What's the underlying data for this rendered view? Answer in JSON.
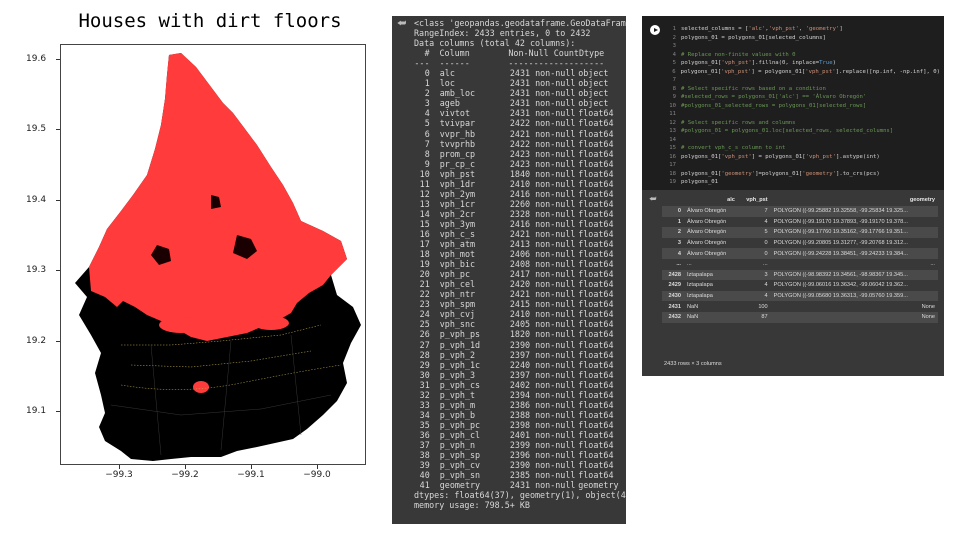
{
  "map": {
    "title": "Houses with dirt floors",
    "yticks": [
      "19.6",
      "19.5",
      "19.4",
      "19.3",
      "19.2",
      "19.1"
    ],
    "xticks": [
      "−99.3",
      "−99.2",
      "−99.1",
      "−99.0"
    ],
    "colors": {
      "background": "#000000",
      "fill": "#ff3b3b",
      "highlight": "#ffe066"
    }
  },
  "info": {
    "output_icon": "output-icon",
    "header_lines": [
      "<class 'geopandas.geodataframe.GeoDataFrame'>",
      "RangeIndex: 2433 entries, 0 to 2432",
      "Data columns (total 42 columns):"
    ],
    "col_header": {
      "num": "#",
      "column": "Column",
      "count": "Non-Null Count",
      "dtype": "Dtype"
    },
    "col_sep": {
      "num": "---",
      "column": "------",
      "count": "--------------",
      "dtype": "-----"
    },
    "rows": [
      [
        "0",
        "alc",
        "2431 non-null",
        "object"
      ],
      [
        "1",
        "loc",
        "2431 non-null",
        "object"
      ],
      [
        "2",
        "amb_loc",
        "2431 non-null",
        "object"
      ],
      [
        "3",
        "ageb",
        "2431 non-null",
        "object"
      ],
      [
        "4",
        "vivtot",
        "2431 non-null",
        "float64"
      ],
      [
        "5",
        "tvivpar",
        "2422 non-null",
        "float64"
      ],
      [
        "6",
        "vvpr_hb",
        "2421 non-null",
        "float64"
      ],
      [
        "7",
        "tvvprhb",
        "2422 non-null",
        "float64"
      ],
      [
        "8",
        "prom_cp",
        "2423 non-null",
        "float64"
      ],
      [
        "9",
        "pr_cp_c",
        "2423 non-null",
        "float64"
      ],
      [
        "10",
        "vph_pst",
        "1840 non-null",
        "float64"
      ],
      [
        "11",
        "vph_1dr",
        "2410 non-null",
        "float64"
      ],
      [
        "12",
        "vph_2ym",
        "2416 non-null",
        "float64"
      ],
      [
        "13",
        "vph_1cr",
        "2260 non-null",
        "float64"
      ],
      [
        "14",
        "vph_2cr",
        "2328 non-null",
        "float64"
      ],
      [
        "15",
        "vph_3ym",
        "2416 non-null",
        "float64"
      ],
      [
        "16",
        "vph_c_s",
        "2421 non-null",
        "float64"
      ],
      [
        "17",
        "vph_atm",
        "2413 non-null",
        "float64"
      ],
      [
        "18",
        "vph_mot",
        "2406 non-null",
        "float64"
      ],
      [
        "19",
        "vph_bic",
        "2408 non-null",
        "float64"
      ],
      [
        "20",
        "vph_pc",
        "2417 non-null",
        "float64"
      ],
      [
        "21",
        "vph_cel",
        "2420 non-null",
        "float64"
      ],
      [
        "22",
        "vph_ntr",
        "2421 non-null",
        "float64"
      ],
      [
        "23",
        "vph_spm",
        "2415 non-null",
        "float64"
      ],
      [
        "24",
        "vph_cvj",
        "2410 non-null",
        "float64"
      ],
      [
        "25",
        "vph_snc",
        "2405 non-null",
        "float64"
      ],
      [
        "26",
        "p_vph_ps",
        "1820 non-null",
        "float64"
      ],
      [
        "27",
        "p_vph_1d",
        "2390 non-null",
        "float64"
      ],
      [
        "28",
        "p_vph_2",
        "2397 non-null",
        "float64"
      ],
      [
        "29",
        "p_vph_1c",
        "2240 non-null",
        "float64"
      ],
      [
        "30",
        "p_vph_3",
        "2397 non-null",
        "float64"
      ],
      [
        "31",
        "p_vph_cs",
        "2402 non-null",
        "float64"
      ],
      [
        "32",
        "p_vph_t",
        "2394 non-null",
        "float64"
      ],
      [
        "33",
        "p_vph_m",
        "2386 non-null",
        "float64"
      ],
      [
        "34",
        "p_vph_b",
        "2388 non-null",
        "float64"
      ],
      [
        "35",
        "p_vph_pc",
        "2398 non-null",
        "float64"
      ],
      [
        "36",
        "p_vph_cl",
        "2401 non-null",
        "float64"
      ],
      [
        "37",
        "p_vph_n",
        "2399 non-null",
        "float64"
      ],
      [
        "38",
        "p_vph_sp",
        "2396 non-null",
        "float64"
      ],
      [
        "39",
        "p_vph_cv",
        "2390 non-null",
        "float64"
      ],
      [
        "40",
        "p_vph_sn",
        "2385 non-null",
        "float64"
      ],
      [
        "41",
        "geometry",
        "2431 non-null",
        "geometry"
      ]
    ],
    "footer_lines": [
      "dtypes: float64(37), geometry(1), object(4)",
      "memory usage: 798.5+ KB"
    ]
  },
  "code": {
    "lines": [
      [
        [
          "n",
          "1"
        ],
        [
          "t",
          "selected_columns = ["
        ],
        [
          "s",
          "'alc'"
        ],
        [
          "t",
          ","
        ],
        [
          "s",
          "'vph_pst'"
        ],
        [
          "t",
          ", "
        ],
        [
          "s",
          "'geometry'"
        ],
        [
          "t",
          "]"
        ]
      ],
      [
        [
          "n",
          "2"
        ],
        [
          "t",
          "polygons_01 = polygons_01[selected_columns]"
        ]
      ],
      [
        [
          "n",
          "3"
        ]
      ],
      [
        [
          "n",
          "4"
        ],
        [
          "c",
          "# Replace non-finite values with 0"
        ]
      ],
      [
        [
          "n",
          "5"
        ],
        [
          "t",
          "polygons_01["
        ],
        [
          "s",
          "'vph_pst'"
        ],
        [
          "t",
          "].fillna(0, inplace="
        ],
        [
          "k",
          "True"
        ],
        [
          "t",
          ")"
        ]
      ],
      [
        [
          "n",
          "6"
        ],
        [
          "t",
          "polygons_01["
        ],
        [
          "s",
          "'vph_pst'"
        ],
        [
          "t",
          "] = polygons_01["
        ],
        [
          "s",
          "'vph_pst'"
        ],
        [
          "t",
          "].replace([np.inf, -np.inf], 0)"
        ]
      ],
      [
        [
          "n",
          "7"
        ]
      ],
      [
        [
          "n",
          "8"
        ],
        [
          "c",
          "# Select specific rows based on a condition"
        ]
      ],
      [
        [
          "n",
          "9"
        ],
        [
          "c",
          "#selected_rows = polygons_01['alc'] == 'Álvaro Obregón'"
        ]
      ],
      [
        [
          "n",
          "10"
        ],
        [
          "c",
          "#polygons_01_selected_rows = polygons_01[selected_rows]"
        ]
      ],
      [
        [
          "n",
          "11"
        ]
      ],
      [
        [
          "n",
          "12"
        ],
        [
          "c",
          "# Select specific rows and columns"
        ]
      ],
      [
        [
          "n",
          "13"
        ],
        [
          "c",
          "#polygons_01 = polygons_01.loc[selected_rows, selected_columns]"
        ]
      ],
      [
        [
          "n",
          "14"
        ]
      ],
      [
        [
          "n",
          "15"
        ],
        [
          "c",
          "# convert vph_c_s column to int"
        ]
      ],
      [
        [
          "n",
          "16"
        ],
        [
          "t",
          "polygons_01["
        ],
        [
          "s",
          "'vph_pst'"
        ],
        [
          "t",
          "] = polygons_01["
        ],
        [
          "s",
          "'vph_pst'"
        ],
        [
          "t",
          "].astype(int)"
        ]
      ],
      [
        [
          "n",
          "17"
        ]
      ],
      [
        [
          "n",
          "18"
        ],
        [
          "t",
          "polygons_01["
        ],
        [
          "s",
          "'geometry'"
        ],
        [
          "t",
          "]=polygons_01["
        ],
        [
          "s",
          "'geometry'"
        ],
        [
          "t",
          "].to_crs(pcs)"
        ]
      ],
      [
        [
          "n",
          "19"
        ],
        [
          "t",
          "polygons_01"
        ]
      ]
    ]
  },
  "dataframe": {
    "columns": [
      "",
      "alc",
      "vph_pst",
      "geometry"
    ],
    "rows": [
      [
        "0",
        "Álvaro Obregón",
        "7",
        "POLYGON ((-99.25882 19.32558, -99.25834 19.325..."
      ],
      [
        "1",
        "Álvaro Obregón",
        "4",
        "POLYGON ((-99.19170 19.37893, -99.19170 19.378..."
      ],
      [
        "2",
        "Álvaro Obregón",
        "5",
        "POLYGON ((-99.17760 19.35162, -99.17766 19.351..."
      ],
      [
        "3",
        "Álvaro Obregón",
        "0",
        "POLYGON ((-99.20805 19.31277, -99.20768 19.312..."
      ],
      [
        "4",
        "Álvaro Obregón",
        "0",
        "POLYGON ((-99.24228 19.38451, -99.24233 19.384..."
      ],
      [
        "...",
        "...",
        "...",
        "..."
      ],
      [
        "2428",
        "Iztapalapa",
        "3",
        "POLYGON ((-98.98392 19.34561, -98.98367 19.345..."
      ],
      [
        "2429",
        "Iztapalapa",
        "4",
        "POLYGON ((-99.06016 19.36342, -99.06042 19.362..."
      ],
      [
        "2430",
        "Iztapalapa",
        "4",
        "POLYGON ((-99.05680 19.36313, -99.05760 19.359..."
      ],
      [
        "2431",
        "NaN",
        "100",
        "None"
      ],
      [
        "2432",
        "NaN",
        "87",
        "None"
      ]
    ],
    "summary": "2433 rows × 3 columns"
  }
}
